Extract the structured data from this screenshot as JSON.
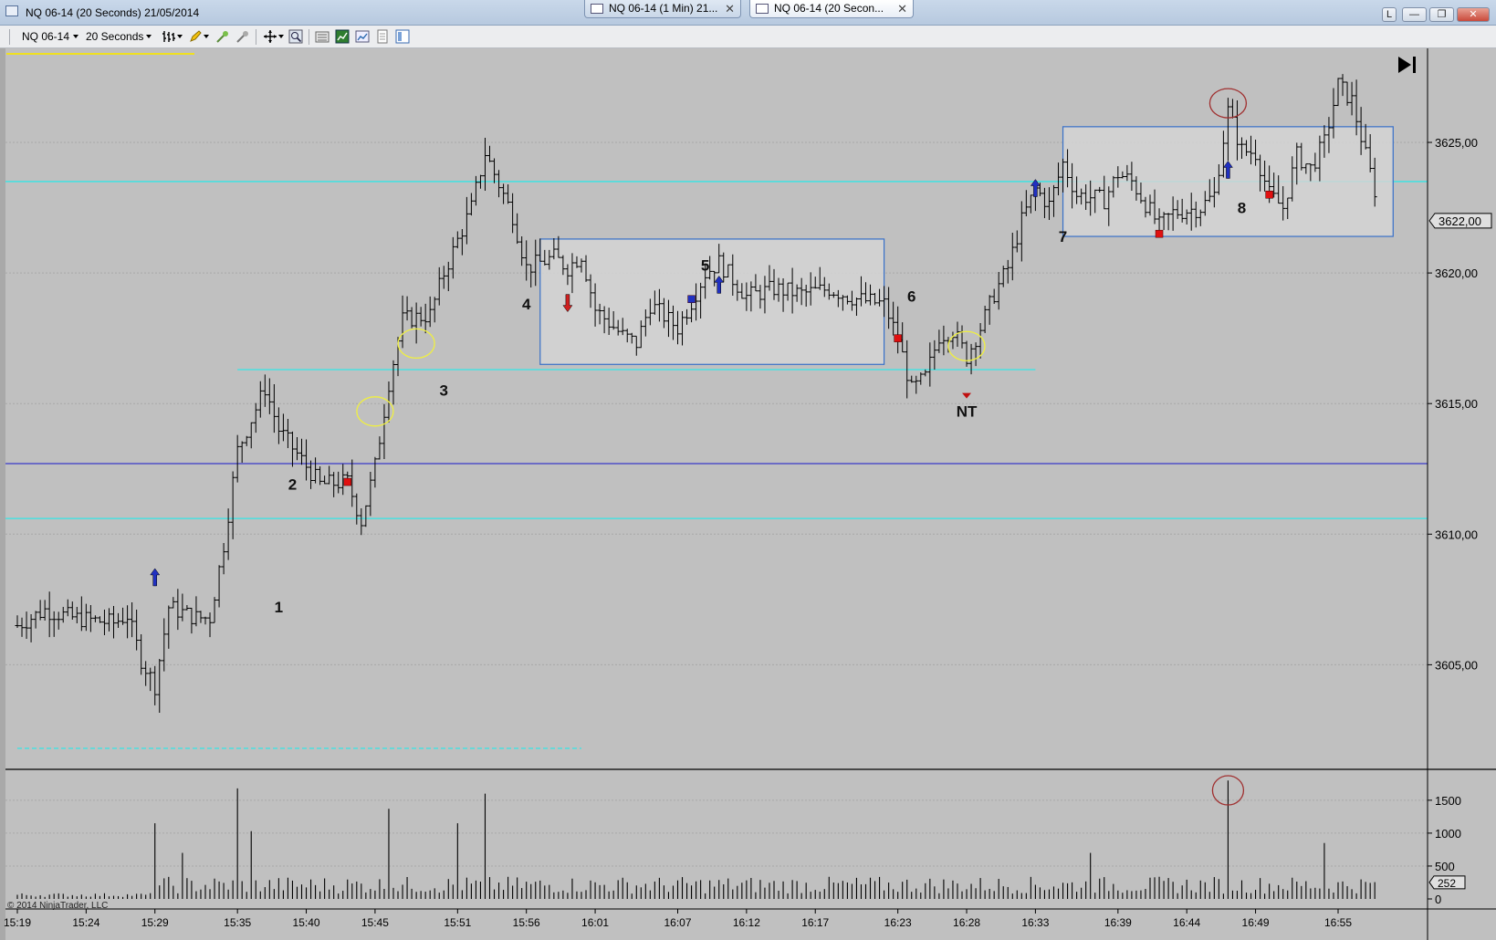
{
  "window": {
    "title": "NQ 06-14 (20 Seconds)  21/05/2014",
    "tabs": [
      {
        "label": "NQ 06-14 (1 Min)  21...",
        "close": "✕",
        "active": false
      },
      {
        "label": "NQ 06-14 (20 Secon...",
        "close": "✕",
        "active": true
      }
    ],
    "buttons": {
      "link": "L",
      "minimize": "—",
      "maximize": "❐",
      "close": "✕"
    }
  },
  "toolbar": {
    "instrument": "NQ 06-14",
    "interval": "20 Seconds",
    "icons": [
      "bar-style-icon",
      "drawing-tools-icon",
      "cross-hair-icon",
      "pointer-icon",
      "scroll-zoom-icon",
      "zoom-icon",
      "data-box-icon",
      "indicators-icon",
      "strategies-icon",
      "properties-icon",
      "chart-trader-icon"
    ]
  },
  "chart_data": {
    "type": "ohlc",
    "instrument": "NQ 06-14",
    "interval": "20 Seconds",
    "price_axis": {
      "ticks": [
        "3625,00",
        "3620,00",
        "3615,00",
        "3610,00",
        "3605,00"
      ],
      "tick_values": [
        3625,
        3620,
        3615,
        3610,
        3605
      ],
      "range": [
        3601.1,
        3628.6
      ]
    },
    "last_price_label": "3622,00",
    "last_price": 3622,
    "volume_axis": {
      "ticks": [
        "1500",
        "1000",
        "500",
        "0"
      ],
      "tick_values": [
        1500,
        1000,
        500,
        0
      ],
      "range": [
        0,
        1900
      ]
    },
    "last_volume_label": "252",
    "last_volume": 252,
    "time_ticks": [
      "15:19",
      "15:24",
      "15:29",
      "15:35",
      "15:40",
      "15:45",
      "15:51",
      "15:56",
      "16:01",
      "16:07",
      "16:12",
      "16:17",
      "16:23",
      "16:28",
      "16:33",
      "16:39",
      "16:44",
      "16:49",
      "16:55"
    ],
    "copyright": "© 2014 NinjaTrader, LLC",
    "background": "#c0c0c0",
    "horizontal_lines": [
      {
        "price": 3623.5,
        "color": "#33e6e6",
        "style": "solid",
        "extent": "full"
      },
      {
        "price": 3616.3,
        "color": "#33e6e6",
        "style": "solid",
        "extent": "15:35-16:33"
      },
      {
        "price": 3612.7,
        "color": "#3838c8",
        "style": "solid",
        "extent": "full"
      },
      {
        "price": 3610.6,
        "color": "#33e6e6",
        "style": "solid",
        "extent": "full"
      },
      {
        "price": 3601.8,
        "color": "#33e6e6",
        "style": "dashed",
        "extent": "15:19-16:00"
      }
    ],
    "rectangles": [
      {
        "from": "15:57",
        "to": "16:22",
        "high": 3621.3,
        "low": 3616.5,
        "color": "#3870c8"
      },
      {
        "from": "16:35",
        "to": "16:59",
        "high": 3625.6,
        "low": 3621.4,
        "color": "#3870c8"
      }
    ],
    "ellipses": [
      {
        "time": "15:45",
        "price": 3614.7,
        "color": "#f0f040"
      },
      {
        "time": "15:48",
        "price": 3617.3,
        "color": "#f0f040"
      },
      {
        "time": "16:28",
        "price": 3617.2,
        "color": "#f0f040"
      },
      {
        "time": "16:47",
        "price": 3626.5,
        "color": "#a03030"
      }
    ],
    "volume_ellipses": [
      {
        "time": "16:47",
        "volume": 1650,
        "color": "#a03030"
      }
    ],
    "annotations": [
      {
        "text": "1",
        "time": "15:38",
        "price": 3607.0
      },
      {
        "text": "2",
        "time": "15:39",
        "price": 3611.7
      },
      {
        "text": "3",
        "time": "15:50",
        "price": 3615.3
      },
      {
        "text": "4",
        "time": "15:56",
        "price": 3618.6
      },
      {
        "text": "5",
        "time": "16:09",
        "price": 3620.1
      },
      {
        "text": "6",
        "time": "16:24",
        "price": 3618.9
      },
      {
        "text": "NT",
        "time": "16:28",
        "price": 3614.5
      },
      {
        "text": "7",
        "time": "16:35",
        "price": 3621.2
      },
      {
        "text": "8",
        "time": "16:48",
        "price": 3622.3
      }
    ],
    "arrows": [
      {
        "time": "15:29",
        "price": 3608.3,
        "direction": "up",
        "color": "#2030c0"
      },
      {
        "time": "15:59",
        "price": 3618.9,
        "direction": "down",
        "color": "#d02020"
      },
      {
        "time": "16:10",
        "price": 3619.5,
        "direction": "up",
        "color": "#2030c0"
      },
      {
        "time": "16:33",
        "price": 3623.2,
        "direction": "up",
        "color": "#2030c0"
      },
      {
        "time": "16:47",
        "price": 3623.9,
        "direction": "up",
        "color": "#2030c0"
      }
    ],
    "markers": [
      {
        "time": "15:43",
        "price": 3612.0,
        "color": "#e01010"
      },
      {
        "time": "16:08",
        "price": 3619.0,
        "color": "#2030c0"
      },
      {
        "time": "16:23",
        "price": 3617.5,
        "color": "#e01010"
      },
      {
        "time": "16:42",
        "price": 3621.5,
        "color": "#e01010"
      },
      {
        "time": "16:50",
        "price": 3623.0,
        "color": "#e01010"
      }
    ],
    "triangles": [
      {
        "time": "16:28",
        "price": 3615.3,
        "color": "#c01010"
      }
    ],
    "price_path": [
      {
        "t": "15:19",
        "p": 3606.5
      },
      {
        "t": "15:21",
        "p": 3607.1
      },
      {
        "t": "15:23",
        "p": 3606.8
      },
      {
        "t": "15:26",
        "p": 3606.6
      },
      {
        "t": "15:27",
        "p": 3606.9
      },
      {
        "t": "15:28",
        "p": 3605.2
      },
      {
        "t": "15:29",
        "p": 3604.2
      },
      {
        "t": "15:30",
        "p": 3607.2
      },
      {
        "t": "15:32",
        "p": 3606.8
      },
      {
        "t": "15:33",
        "p": 3606.8
      },
      {
        "t": "15:34",
        "p": 3609.6
      },
      {
        "t": "15:35",
        "p": 3613.2
      },
      {
        "t": "15:37",
        "p": 3615.6
      },
      {
        "t": "15:38",
        "p": 3614.0
      },
      {
        "t": "15:40",
        "p": 3612.6
      },
      {
        "t": "15:41",
        "p": 3611.9
      },
      {
        "t": "15:43",
        "p": 3612.0
      },
      {
        "t": "15:44",
        "p": 3610.5
      },
      {
        "t": "15:45",
        "p": 3612.6
      },
      {
        "t": "15:46",
        "p": 3615.8
      },
      {
        "t": "15:47",
        "p": 3618.2
      },
      {
        "t": "15:49",
        "p": 3618.4
      },
      {
        "t": "15:50",
        "p": 3620.0
      },
      {
        "t": "15:52",
        "p": 3622.5
      },
      {
        "t": "15:53",
        "p": 3624.6
      },
      {
        "t": "15:55",
        "p": 3622.2
      },
      {
        "t": "15:56",
        "p": 3620.2
      },
      {
        "t": "15:58",
        "p": 3620.6
      },
      {
        "t": "15:59",
        "p": 3620.2
      },
      {
        "t": "16:00",
        "p": 3620.7
      },
      {
        "t": "16:01",
        "p": 3618.6
      },
      {
        "t": "16:03",
        "p": 3617.6
      },
      {
        "t": "16:04",
        "p": 3617.3
      },
      {
        "t": "16:05",
        "p": 3618.8
      },
      {
        "t": "16:07",
        "p": 3617.9
      },
      {
        "t": "16:08",
        "p": 3618.9
      },
      {
        "t": "16:09",
        "p": 3620.0
      },
      {
        "t": "16:10",
        "p": 3620.4
      },
      {
        "t": "16:12",
        "p": 3619.1
      },
      {
        "t": "16:14",
        "p": 3619.4
      },
      {
        "t": "16:16",
        "p": 3619.2
      },
      {
        "t": "16:18",
        "p": 3619.4
      },
      {
        "t": "16:20",
        "p": 3619.0
      },
      {
        "t": "16:22",
        "p": 3618.8
      },
      {
        "t": "16:23",
        "p": 3617.5
      },
      {
        "t": "16:24",
        "p": 3615.5
      },
      {
        "t": "16:25",
        "p": 3616.0
      },
      {
        "t": "16:26",
        "p": 3617.6
      },
      {
        "t": "16:27",
        "p": 3617.8
      },
      {
        "t": "16:28",
        "p": 3616.8
      },
      {
        "t": "16:29",
        "p": 3617.9
      },
      {
        "t": "16:30",
        "p": 3619.2
      },
      {
        "t": "16:31",
        "p": 3620.2
      },
      {
        "t": "16:32",
        "p": 3622.0
      },
      {
        "t": "16:33",
        "p": 3623.2
      },
      {
        "t": "16:34",
        "p": 3622.6
      },
      {
        "t": "16:35",
        "p": 3624.2
      },
      {
        "t": "16:36",
        "p": 3623.0
      },
      {
        "t": "16:38",
        "p": 3622.8
      },
      {
        "t": "16:39",
        "p": 3623.8
      },
      {
        "t": "16:40",
        "p": 3623.5
      },
      {
        "t": "16:42",
        "p": 3621.8
      },
      {
        "t": "16:43",
        "p": 3622.3
      },
      {
        "t": "16:45",
        "p": 3622.5
      },
      {
        "t": "16:46",
        "p": 3623.0
      },
      {
        "t": "16:47",
        "p": 3626.2
      },
      {
        "t": "16:48",
        "p": 3624.7
      },
      {
        "t": "16:49",
        "p": 3624.6
      },
      {
        "t": "16:50",
        "p": 3623.0
      },
      {
        "t": "16:51",
        "p": 3622.5
      },
      {
        "t": "16:52",
        "p": 3624.5
      },
      {
        "t": "16:53",
        "p": 3624.0
      },
      {
        "t": "16:54",
        "p": 3625.0
      },
      {
        "t": "16:55",
        "p": 3627.2
      },
      {
        "t": "16:56",
        "p": 3626.6
      },
      {
        "t": "16:57",
        "p": 3624.5
      },
      {
        "t": "16:58",
        "p": 3622.5
      }
    ],
    "volume_spikes": [
      {
        "t": "15:29",
        "v": 1150
      },
      {
        "t": "15:31",
        "v": 700
      },
      {
        "t": "15:35",
        "v": 1680
      },
      {
        "t": "15:36",
        "v": 1030
      },
      {
        "t": "15:46",
        "v": 1370
      },
      {
        "t": "15:51",
        "v": 1150
      },
      {
        "t": "15:53",
        "v": 1600
      },
      {
        "t": "16:37",
        "v": 700
      },
      {
        "t": "16:47",
        "v": 1800
      },
      {
        "t": "16:54",
        "v": 850
      }
    ],
    "volume_baseline": 200
  }
}
